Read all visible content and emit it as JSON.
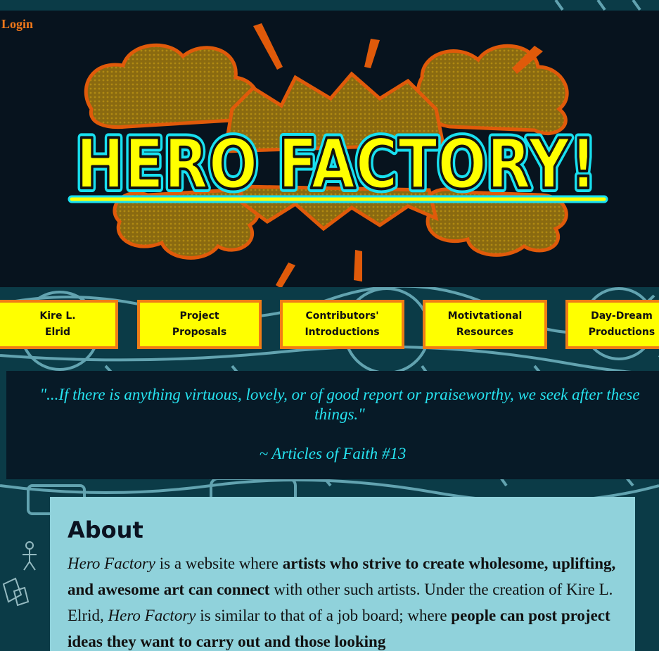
{
  "header": {
    "login_label": "Login",
    "logo_text": "HERO FACTORY!"
  },
  "nav": {
    "items": [
      {
        "label": "Kire L.\nElrid"
      },
      {
        "label": "Project\nProposals"
      },
      {
        "label": "Contributors'\nIntroductions"
      },
      {
        "label": "Motivtational\nResources"
      },
      {
        "label": "Day-Dream\nProductions"
      }
    ]
  },
  "quote": {
    "text": "\"...If there is anything virtuous, lovely, or of good report or praiseworthy, we seek after these things.\"",
    "attribution": "~ Articles of Faith #13"
  },
  "about": {
    "heading": "About",
    "p_part1": "Hero Factory",
    "p_part2": " is a website where ",
    "p_part3": "artists who strive to create wholesome, uplifting, and awesome art can connect",
    "p_part4": " with other such artists. Under the creation of Kire L. Elrid, ",
    "p_part5": "Hero Factory",
    "p_part6": " is similar to that of a job board; where ",
    "p_part7": "people can post project ideas they want to carry out and those looking"
  },
  "colors": {
    "login": "#f0781a",
    "nav_button_bg": "#ffff00",
    "nav_button_border": "#f07c16",
    "quote_text": "#26e3f0",
    "about_bg": "#90d2db"
  }
}
